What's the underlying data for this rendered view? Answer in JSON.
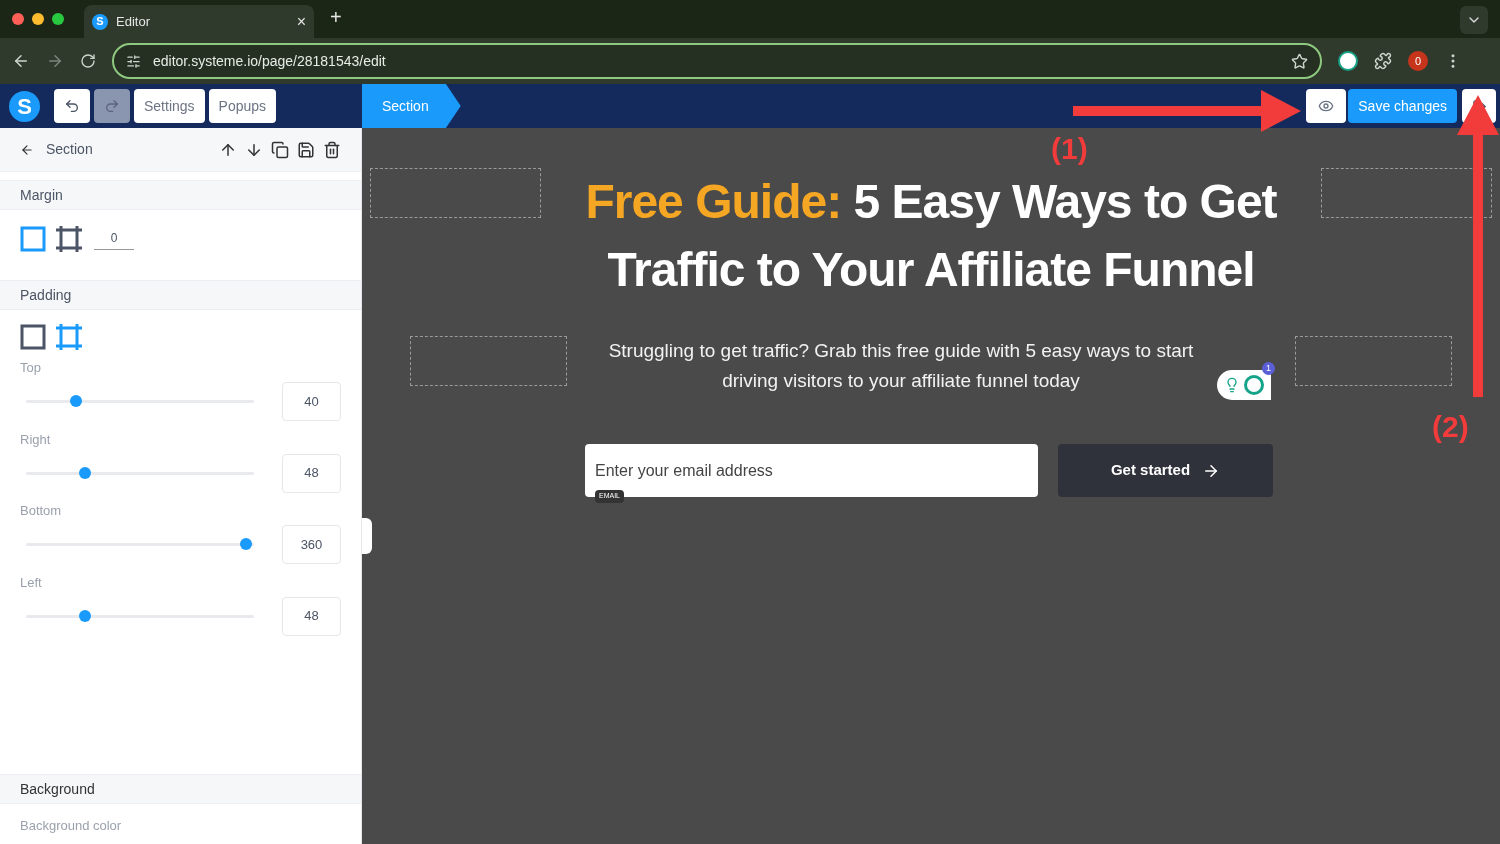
{
  "browser": {
    "tab": {
      "favicon": "S",
      "title": "Editor",
      "close": "×"
    },
    "new_tab": "+",
    "url": "editor.systeme.io/page/28181543/edit",
    "profile": "0"
  },
  "header": {
    "logo": "S",
    "buttons": [
      "Settings",
      "Popups"
    ],
    "breadcrumb": "Section",
    "save": "Save changes"
  },
  "panel": {
    "title": "Section",
    "margin": {
      "label": "Margin",
      "modes": [
        {
          "kind": "all",
          "selected": true
        },
        {
          "kind": "sides",
          "selected": false
        }
      ],
      "value": "0"
    },
    "padding": {
      "label": "Padding",
      "modes": [
        {
          "kind": "all",
          "selected": false
        },
        {
          "kind": "sides",
          "selected": true
        }
      ],
      "sliders": [
        {
          "label": "Top",
          "level": 0.22,
          "value": "40"
        },
        {
          "label": "Right",
          "level": 0.26,
          "value": "48"
        },
        {
          "label": "Bottom",
          "level": 0.965,
          "value": "360"
        },
        {
          "label": "Left",
          "level": 0.26,
          "value": "48"
        }
      ]
    },
    "background": {
      "label": "Background",
      "field": "Background color"
    }
  },
  "canvas": {
    "heading_highlight": "Free Guide:",
    "heading_rest": "5 Easy Ways to Get Traffic to Your Affiliate Funnel",
    "subtext": "Struggling to get traffic? Grab this free guide with 5 easy ways to start driving visitors to your affiliate funnel today",
    "grammarly_count": "1",
    "email": {
      "placeholder": "Enter your email address",
      "tag": "EMAIL"
    },
    "cta": "Get started"
  },
  "annotations": [
    "(1)",
    "(2)"
  ]
}
